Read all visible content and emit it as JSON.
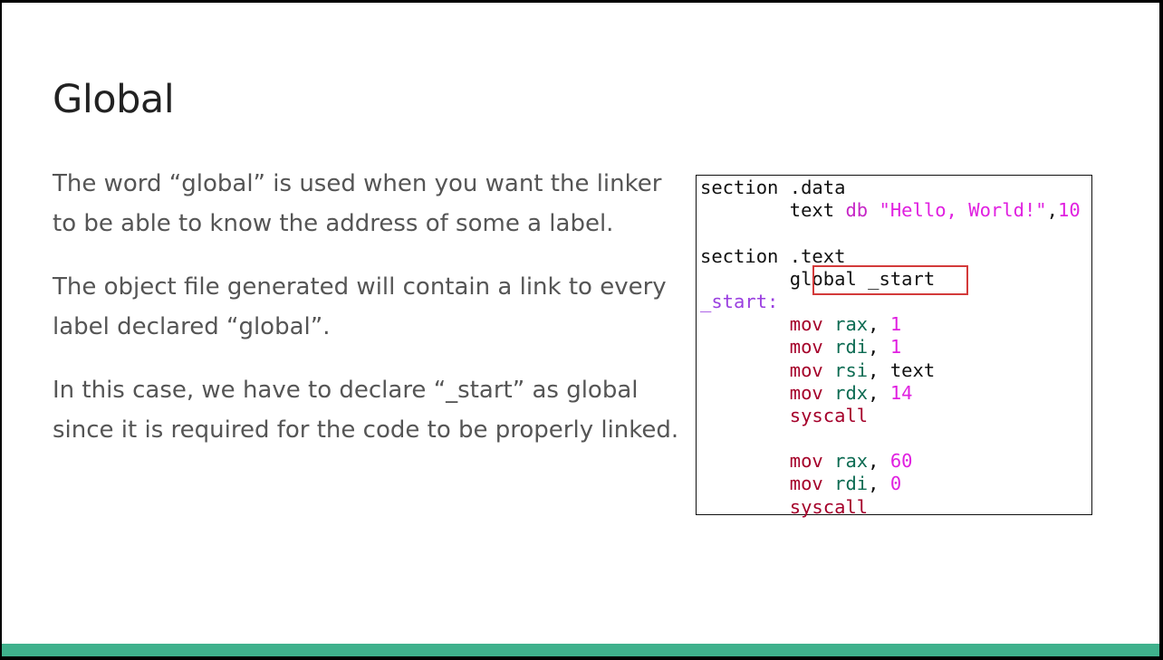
{
  "slide": {
    "title": "Global",
    "paragraphs": [
      "The word “global” is used when you want the linker to be able to know the address of some a label.",
      "The object file generated will contain a link to every label declared “global”.",
      "In this case, we have to declare “_start” as global since it is required for the code to be properly linked."
    ]
  },
  "code": {
    "line1_a": "section",
    "line1_b": " .data",
    "line2_indent": "        ",
    "line2_a": "text",
    "line2_b": " db",
    "line2_c": " \"Hello, World!\"",
    "line2_d": ",",
    "line2_e": "10",
    "line4_a": "section",
    "line4_b": " .text",
    "line5_indent": "        ",
    "line5_a": "global _start",
    "line6_a": "_start:",
    "line7_kw": "mov",
    "line7_reg": " rax",
    "line7_sep": ", ",
    "line7_val": "1",
    "line8_kw": "mov",
    "line8_reg": " rdi",
    "line8_sep": ", ",
    "line8_val": "1",
    "line9_kw": "mov",
    "line9_reg": " rsi",
    "line9_sep": ", ",
    "line9_val": "text",
    "line10_kw": "mov",
    "line10_reg": " rdx",
    "line10_sep": ", ",
    "line10_val": "14",
    "line11_kw": "syscall",
    "line13_kw": "mov",
    "line13_reg": " rax",
    "line13_sep": ", ",
    "line13_val": "60",
    "line14_kw": "mov",
    "line14_reg": " rdi",
    "line14_sep": ", ",
    "line14_val": "0",
    "line15_kw": "syscall",
    "indent": "        "
  },
  "colors": {
    "accent_bar": "#3fb18c",
    "highlight_border": "#d33a3a"
  }
}
